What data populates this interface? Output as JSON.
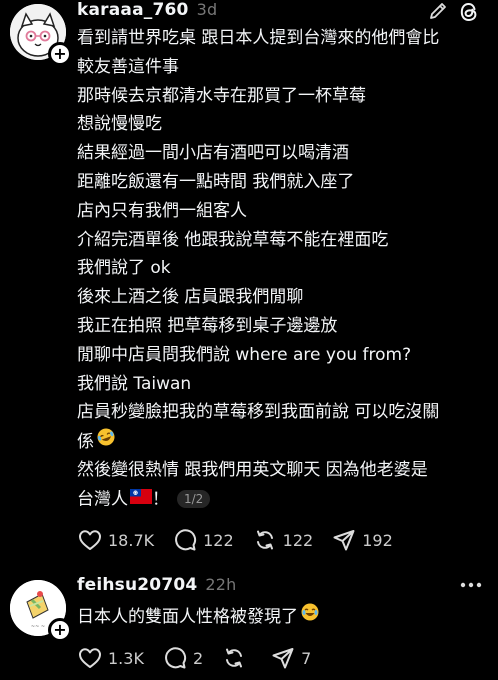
{
  "posts": [
    {
      "username": "karaaa_760",
      "timestamp": "3d",
      "lines": [
        "看到請世界吃桌 跟日本人提到台灣來的他們會比",
        "較友善這件事",
        "那時候去京都清水寺在那買了一杯草莓",
        "想說慢慢吃",
        "結果經過一間小店有酒吧可以喝清酒",
        "距離吃飯還有一點時間 我們就入座了",
        "店內只有我們一組客人",
        "介紹完酒單後 他跟我說草莓不能在裡面吃",
        "我們說了 ok",
        "後來上酒之後 店員跟我們閒聊",
        "我正在拍照 把草莓移到桌子邊邊放",
        "閒聊中店員問我們說 where are you from?",
        "我們說 Taiwan",
        "店員秒變臉把我的草莓移到我面前說 可以吃沒關",
        "係",
        "然後變很熱情 跟我們用英文聊天 因為他老婆是",
        "台灣人"
      ],
      "after_flag": "！",
      "page_indicator": "1/2",
      "likes": "18.7K",
      "comments": "122",
      "reposts": "122",
      "shares": "192",
      "icons": [
        "edit-icon",
        "threads-logo-icon",
        "heart-icon",
        "comment-icon",
        "repost-icon",
        "share-icon",
        "rofl-emoji",
        "taiwan-flag-emoji"
      ]
    },
    {
      "username": "feihsu20704",
      "timestamp": "22h",
      "lines": [
        "日本人的雙面人性格被發現了"
      ],
      "likes": "1.3K",
      "comments": "2",
      "reposts": "",
      "shares": "7",
      "icons": [
        "more-icon",
        "heart-icon",
        "comment-icon",
        "repost-icon",
        "share-icon",
        "joy-emoji"
      ]
    }
  ],
  "colors": {
    "background": "#000000",
    "text": "#f3f5f7",
    "muted": "#777777",
    "pill": "#262626"
  }
}
